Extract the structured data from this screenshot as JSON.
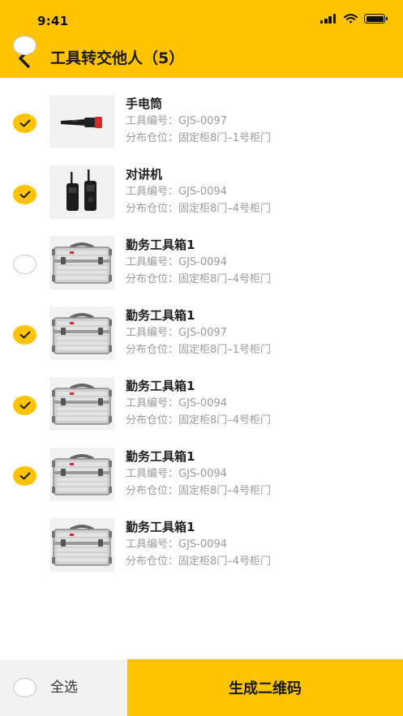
{
  "status_bar": {
    "time": "9:41",
    "icons": [
      "signal-icon",
      "wifi-icon",
      "battery-icon"
    ]
  },
  "header": {
    "back_icon": "chevron-left-icon",
    "title": "工具转交他人（5）",
    "background": "#FFC300"
  },
  "items": [
    {
      "name": "手电筒",
      "code": "工具编号：GJS-0097",
      "location": "分布仓位：固定柜8门–1号柜门",
      "checked": false,
      "image": "flashlight"
    },
    {
      "name": "对讲机",
      "code": "工具编号：GJS-0094",
      "location": "分布仓位：固定柜8门–4号柜门",
      "checked": true,
      "image": "walkie-talkie"
    },
    {
      "name": "勤务工具箱1",
      "code": "工具编号：GJS-0094",
      "location": "分布仓位：固定柜8门–4号柜门",
      "checked": true,
      "image": "toolbox"
    },
    {
      "name": "勤务工具箱1",
      "code": "工具编号：GJS-0097",
      "location": "分布仓位：固定柜8门–1号柜门",
      "checked": false,
      "image": "toolbox"
    },
    {
      "name": "勤务工具箱1",
      "code": "工具编号：GJS-0094",
      "location": "分布仓位：固定柜8门–4号柜门",
      "checked": true,
      "image": "toolbox"
    },
    {
      "name": "勤务工具箱1",
      "code": "工具编号：GJS-0094",
      "location": "分布仓位：固定柜8门–4号柜门",
      "checked": true,
      "image": "toolbox"
    },
    {
      "name": "勤务工具箱1",
      "code": "工具编号：GJS-0094",
      "location": "分布仓位：固定柜8门–4号柜门",
      "checked": true,
      "image": "toolbox"
    }
  ],
  "footer": {
    "select_all_label": "全选",
    "select_all_checked": false,
    "generate_qr_label": "生成二维码"
  },
  "colors": {
    "accent": "#FFC300",
    "unchecked_border": "#c8c8c8",
    "meta_text": "#9a9a9a",
    "footer_left_bg": "#f2f2f2"
  }
}
